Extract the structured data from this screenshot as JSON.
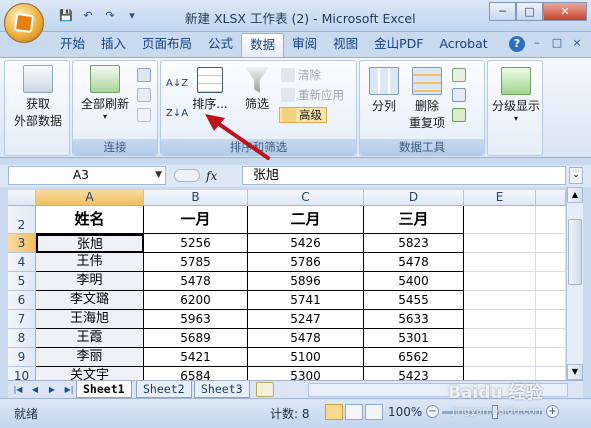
{
  "window": {
    "title": "新建 XLSX 工作表 (2) - Microsoft Excel",
    "controls": {
      "minimize": "─",
      "maximize": "□",
      "close": "✕"
    }
  },
  "quick_access": [
    "save-icon",
    "undo-icon",
    "redo-icon",
    "customize-icon"
  ],
  "tabs": [
    {
      "label": "开始",
      "active": false
    },
    {
      "label": "插入",
      "active": false
    },
    {
      "label": "页面布局",
      "active": false
    },
    {
      "label": "公式",
      "active": false
    },
    {
      "label": "数据",
      "active": true
    },
    {
      "label": "审阅",
      "active": false
    },
    {
      "label": "视图",
      "active": false
    },
    {
      "label": "金山PDF",
      "active": false
    },
    {
      "label": "Acrobat",
      "active": false
    }
  ],
  "ribbon": {
    "get_external": "获取\n外部数据",
    "get_external_line1": "获取",
    "get_external_line2": "外部数据",
    "refresh_all": "全部刷新",
    "connections_label": "连接",
    "sort_button": "排序...",
    "filter_button": "筛选",
    "clear": "清除",
    "reapply": "重新应用",
    "advanced": "高级",
    "sort_filter_label": "排序和筛选",
    "text_to_columns": "分列",
    "remove_duplicates_line1": "删除",
    "remove_duplicates_line2": "重复项",
    "data_tools_label": "数据工具",
    "outline": "分级显示",
    "sort_az": "A↓Z",
    "sort_za": "Z↓A"
  },
  "formula_bar": {
    "name_box": "A3",
    "fx": "fx",
    "content": "张旭"
  },
  "grid": {
    "columns": [
      "A",
      "B",
      "C",
      "D",
      "E"
    ],
    "rows": [
      "2",
      "3",
      "4",
      "5",
      "6",
      "7",
      "8",
      "9",
      "10"
    ],
    "header": [
      "姓名",
      "一月",
      "二月",
      "三月"
    ],
    "data": [
      [
        "张旭",
        "5256",
        "5426",
        "5823"
      ],
      [
        "王伟",
        "5785",
        "5786",
        "5478"
      ],
      [
        "李明",
        "5478",
        "5896",
        "5400"
      ],
      [
        "李文璐",
        "6200",
        "5741",
        "5455"
      ],
      [
        "王海旭",
        "5963",
        "5247",
        "5633"
      ],
      [
        "王霞",
        "5689",
        "5478",
        "5301"
      ],
      [
        "李丽",
        "5421",
        "5100",
        "6562"
      ],
      [
        "关文宇",
        "6584",
        "5300",
        "5423"
      ]
    ]
  },
  "sheets": [
    "Sheet1",
    "Sheet2",
    "Sheet3"
  ],
  "status": {
    "ready": "就绪",
    "count": "计数: 8",
    "zoom": "100%"
  },
  "watermark": {
    "main": "Baidu 经验",
    "sub": "jingyan.baidu.com"
  },
  "colors": {
    "accent": "#15428b",
    "selected_header": "#f1c15f",
    "arrow": "#c0121b"
  }
}
